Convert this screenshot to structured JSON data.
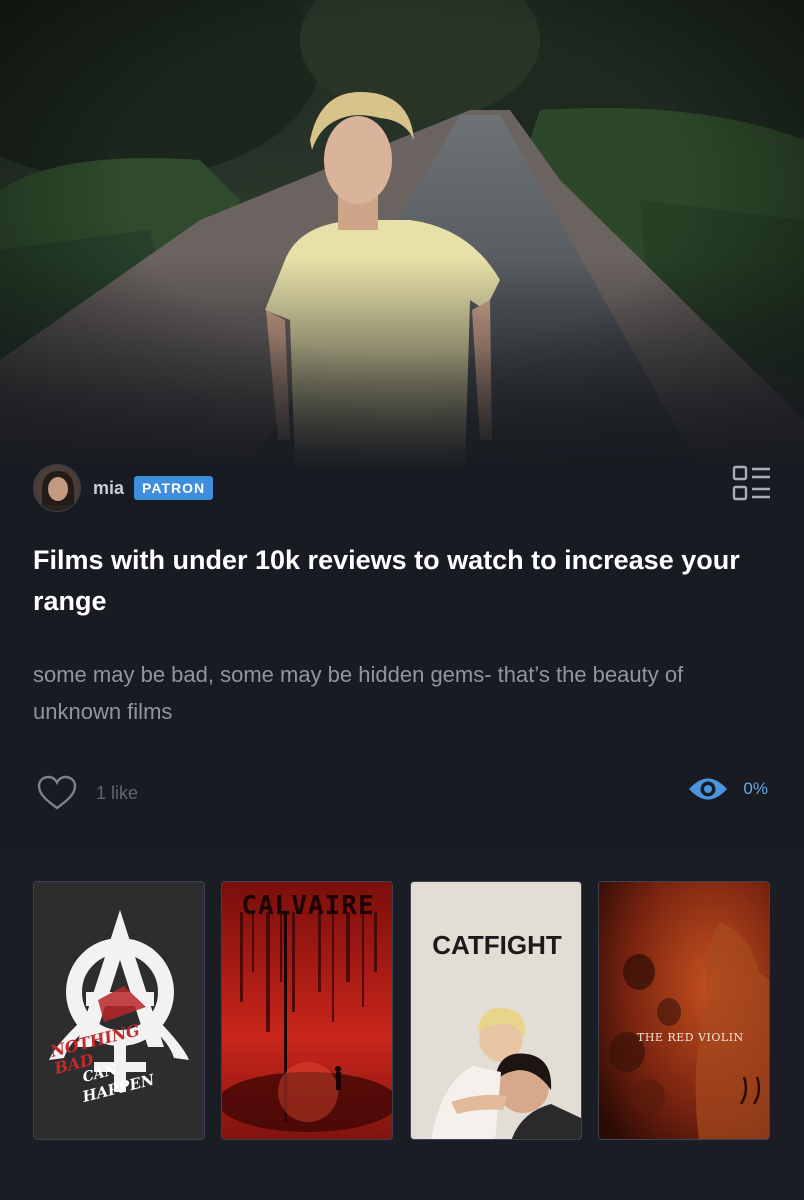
{
  "author": {
    "name": "mia",
    "badge": "PATRON"
  },
  "list": {
    "title": "Films with under 10k reviews to watch to increase your range",
    "description": "some may be bad, some may be hidden gems- that’s the beauty of unknown films"
  },
  "stats": {
    "likes": "1 like",
    "watched_percent": "0%"
  },
  "posters": [
    {
      "title_text": "NOTHING BAD CAN HAPPEN",
      "icon": "anarchy-feminist-symbol"
    },
    {
      "title_text": "CALVAIRE",
      "icon": "blood-drip-title"
    },
    {
      "title_text": "CATFIGHT",
      "icon": ""
    },
    {
      "title_text": "THE RED VIOLIN",
      "icon": ""
    }
  ],
  "colors": {
    "background": "#181b21",
    "badge": "#3f8ede",
    "watch_accent": "#4a95e0",
    "title": "#ffffff",
    "description": "#8d96a4"
  },
  "icons": {
    "list_view": "list-view-icon",
    "like": "heart-icon",
    "watched": "eye-icon"
  }
}
